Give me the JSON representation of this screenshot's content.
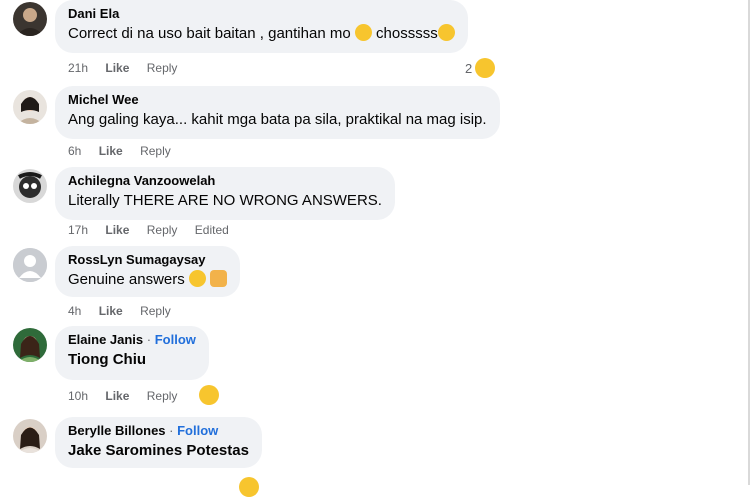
{
  "comments": [
    {
      "author": "Dani Ela",
      "text": "Correct di na uso bait baitan , gantihan mo",
      "text_tail": " chosssss",
      "time": "21h",
      "like": "Like",
      "reply": "Reply",
      "reaction_count": "2"
    },
    {
      "author": "Michel Wee",
      "text": "Ang galing kaya... kahit mga bata pa sila, praktikal na mag isip.",
      "time": "6h",
      "like": "Like",
      "reply": "Reply"
    },
    {
      "author": "Achilegna Vanzoowelah",
      "text": "Literally THERE ARE NO WRONG ANSWERS.",
      "time": "17h",
      "like": "Like",
      "reply": "Reply",
      "edited": "Edited"
    },
    {
      "author": "RossLyn Sumagaysay",
      "text": "Genuine answers",
      "time": "4h",
      "like": "Like",
      "reply": "Reply"
    },
    {
      "author": "Elaine Janis",
      "follow": "Follow",
      "text": "Tiong Chiu",
      "time": "10h",
      "like": "Like",
      "reply": "Reply"
    },
    {
      "author": "Berylle Billones",
      "follow": "Follow",
      "text": "Jake Saromines Potestas"
    }
  ],
  "icons": {
    "laughing": "rolling-on-floor-laughing-emoji",
    "rock": "sign-of-the-horns-emoji",
    "grin": "grinning-reaction-emoji"
  },
  "colors": {
    "bubble": "#f0f2f5",
    "follow": "#216fdb",
    "meta": "#65676b",
    "emoji": "#f7c52e"
  }
}
